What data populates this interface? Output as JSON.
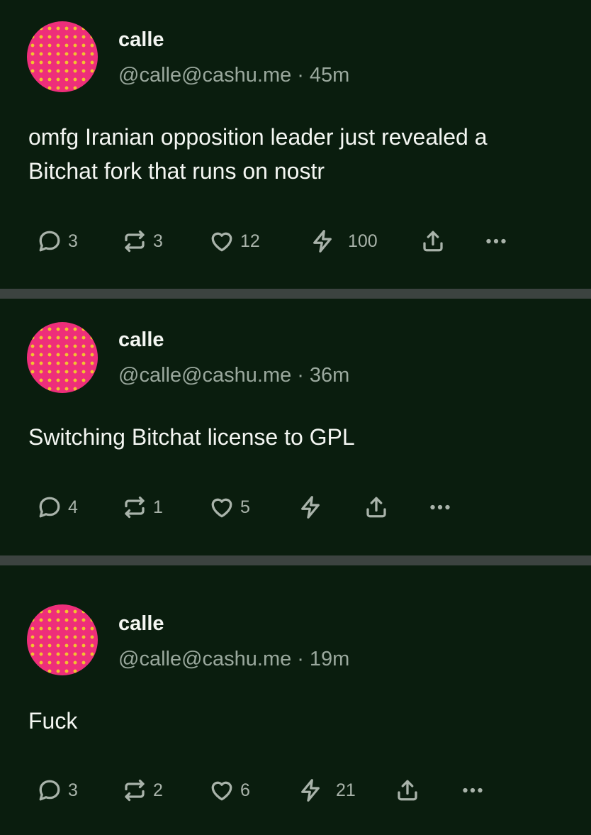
{
  "posts": [
    {
      "name": "calle",
      "handle": "@calle@cashu.me",
      "time": "45m",
      "content_lines": [
        "omfg Iranian opposition leader just revealed a",
        "Bitchat fork that runs on nostr"
      ],
      "counts": {
        "replies": "3",
        "reposts": "3",
        "likes": "12",
        "zaps": "100"
      }
    },
    {
      "name": "calle",
      "handle": "@calle@cashu.me",
      "time": "36m",
      "content_lines": [
        "Switching Bitchat license to GPL"
      ],
      "counts": {
        "replies": "4",
        "reposts": "1",
        "likes": "5",
        "zaps": ""
      }
    },
    {
      "name": "calle",
      "handle": "@calle@cashu.me",
      "time": "19m",
      "content_lines": [
        "Fuck"
      ],
      "counts": {
        "replies": "3",
        "reposts": "2",
        "likes": "6",
        "zaps": "21"
      }
    }
  ],
  "separator": "·",
  "colors": {
    "background": "#0a1d0e",
    "divider": "#3c4340",
    "avatar_pink": "#ee2e7a",
    "avatar_yellow": "#f2c230",
    "muted_text": "#9aa89d"
  },
  "icons": [
    "reply-icon",
    "repost-icon",
    "like-icon",
    "zap-icon",
    "share-icon",
    "more-icon"
  ]
}
